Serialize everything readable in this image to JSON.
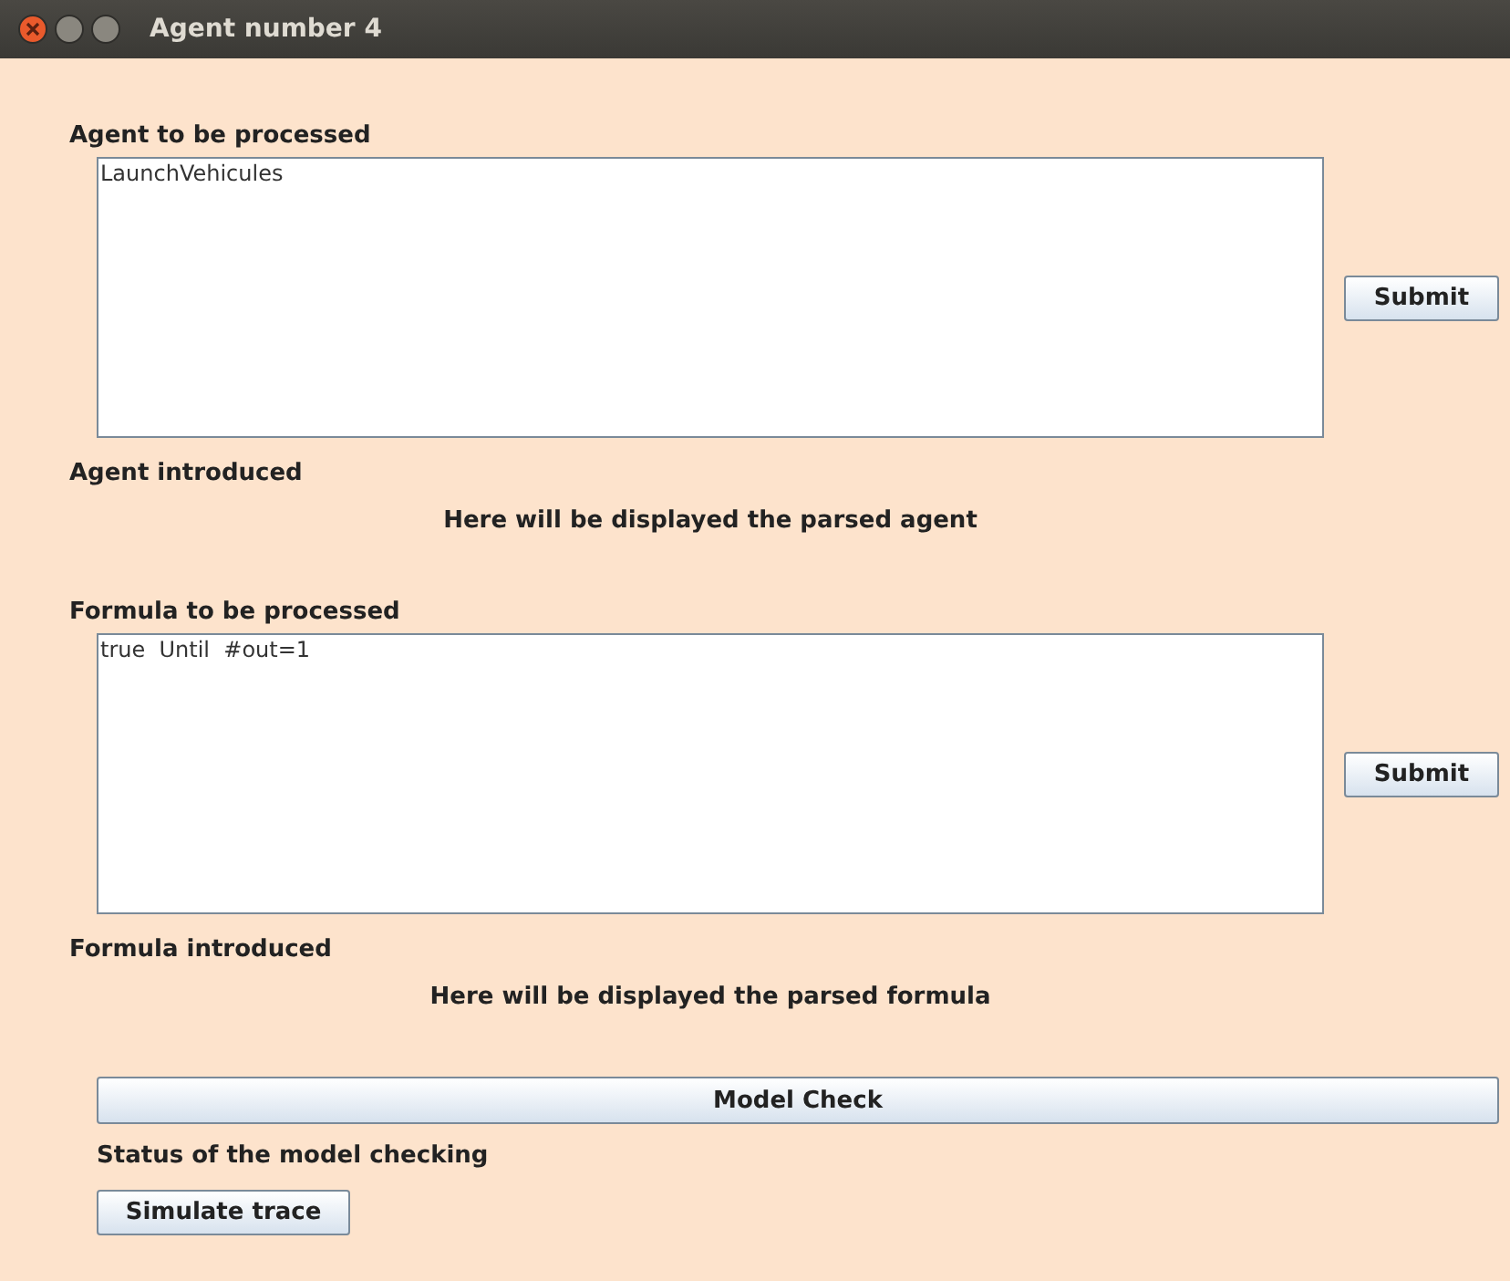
{
  "window": {
    "title": "Agent number 4"
  },
  "agent_section": {
    "label": "Agent to be processed",
    "input": "LaunchVehicules",
    "button": "Submit",
    "result_label": "Agent introduced",
    "result": "Here will be displayed the parsed agent"
  },
  "formula_section": {
    "label": "Formula to be processed",
    "input": "true  Until  #out=1",
    "button": "Submit",
    "result_label": "Formula introduced",
    "result": "Here will be displayed the parsed formula"
  },
  "model_check_button": "Model Check",
  "status_label": "Status of the model checking",
  "simulate_button": "Simulate trace"
}
